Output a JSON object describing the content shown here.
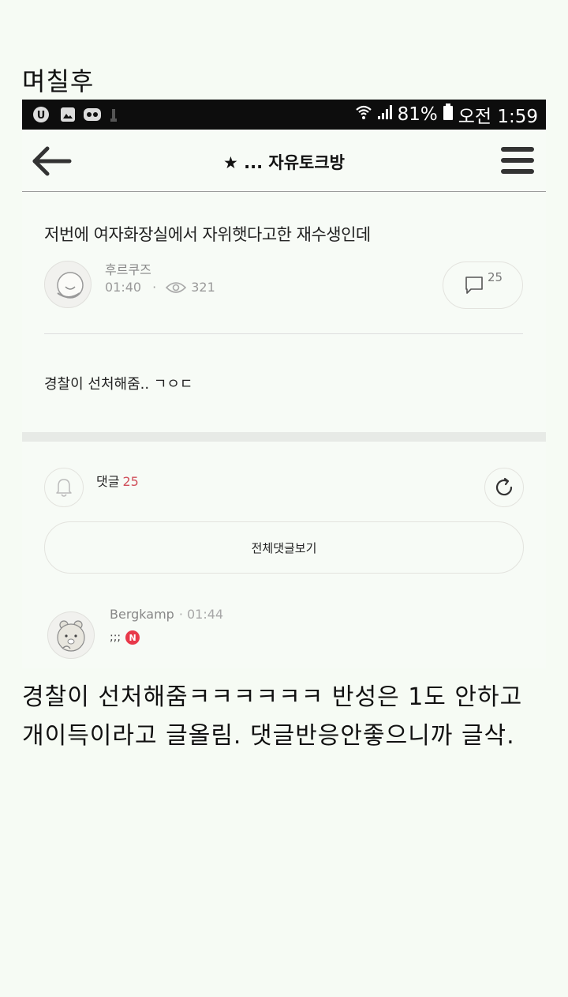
{
  "captions": {
    "top": "며칠후",
    "bottom": "경찰이 선처해줌ㅋㅋㅋㅋㅋㅋ 반성은 1도 안하고 개이득이라고 글올림. 댓글반응안좋으니까 글삭."
  },
  "status_bar": {
    "battery": "81%",
    "time": "오전 1:59",
    "icons": [
      "u-plus-icon",
      "image-icon",
      "media-icon",
      "usb-icon",
      "wifi-icon",
      "signal-icon",
      "battery-icon"
    ]
  },
  "app_bar": {
    "title": "★ ... 자유토크방",
    "back_icon": "back-arrow-icon",
    "menu_icon": "hamburger-menu-icon"
  },
  "post": {
    "title": "저번에 여자화장실에서 자위햇다고한 재수생인데",
    "author": "후르쿠즈",
    "time": "01:40",
    "separator": "·",
    "views": "321",
    "comment_count": "25",
    "body": "경찰이 선처해줌.. ㄱㅇㄷ"
  },
  "comments_section": {
    "label": "댓글",
    "count": "25",
    "view_all_label": "전체댓글보기",
    "icons": [
      "bell-icon",
      "refresh-icon"
    ]
  },
  "comments": [
    {
      "author": "Bergkamp",
      "separator": "·",
      "time": "01:44",
      "text": ";;;",
      "badge": "N"
    }
  ],
  "colors": {
    "accent_count": "#d0505a",
    "new_badge": "#e8394a",
    "status_bar_bg": "#0d0d0d",
    "page_bg": "#f6fbf4"
  }
}
